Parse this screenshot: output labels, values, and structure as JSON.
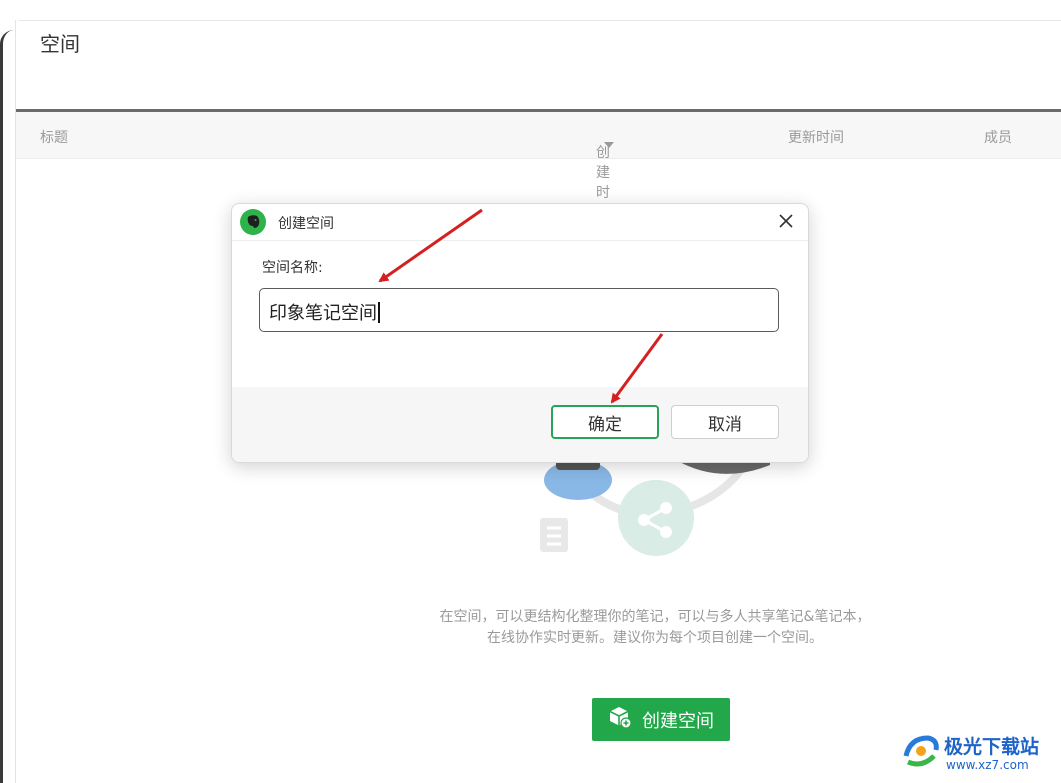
{
  "page": {
    "title": "空间"
  },
  "table": {
    "columns": {
      "title": "标题",
      "created": "创建时间",
      "updated": "更新时间",
      "members": "成员"
    }
  },
  "empty_state": {
    "line1": "在空间，可以更结构化整理你的笔记，可以与多人共享笔记&笔记本，",
    "line2": "在线协作实时更新。建议你为每个项目创建一个空间。",
    "create_button": "创建空间",
    "accent": "#22a84a"
  },
  "dialog": {
    "title": "创建空间",
    "field_label": "空间名称:",
    "field_value": "印象笔记空间",
    "ok_label": "确定",
    "cancel_label": "取消",
    "ok_border": "#2aa35a"
  },
  "watermark": {
    "name": "极光下载站",
    "url": "www.xz7.com"
  },
  "icons": {
    "logo": "elephant-logo-icon",
    "close": "close-icon",
    "sort": "sort-down-icon",
    "create": "cube-plus-icon"
  }
}
